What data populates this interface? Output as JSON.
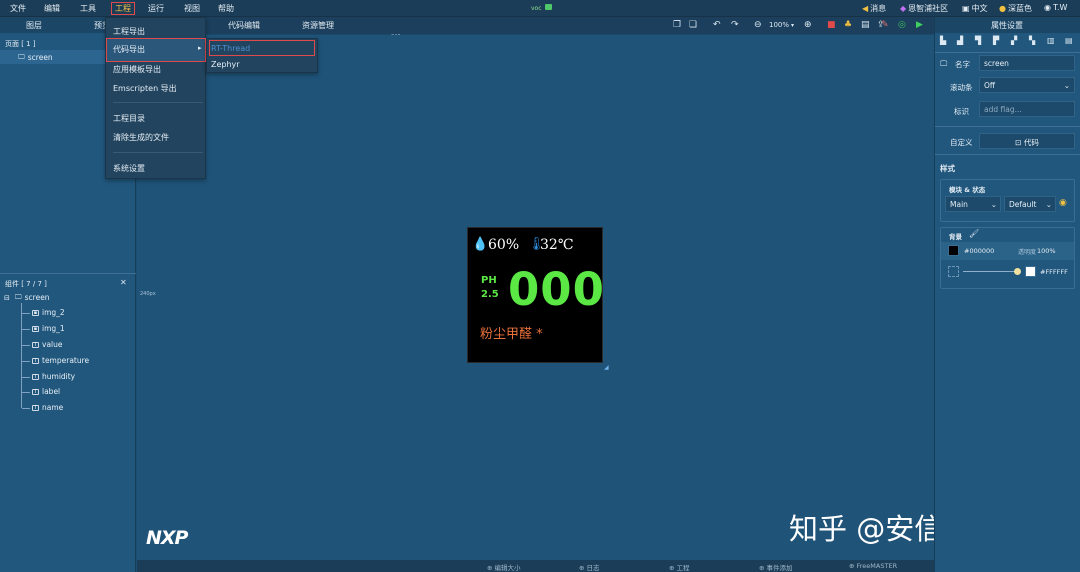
{
  "menubar": {
    "items": [
      "文件",
      "编辑",
      "工具",
      "工程",
      "运行",
      "视图",
      "帮助"
    ],
    "center_logo": "voc",
    "right_items": [
      "消息",
      "恩智浦社区",
      "中文",
      "深蓝色",
      "T.W"
    ]
  },
  "left_panel": {
    "tabs": [
      "图层",
      "预览"
    ],
    "pages_title": "页面 [ 1 ]",
    "pages": [
      "screen"
    ],
    "widgets_title": "组件 [ 7 / 7 ]",
    "widget_root": "screen",
    "widgets": [
      "img_2",
      "img_1",
      "value",
      "temperature",
      "humidity",
      "label",
      "name"
    ]
  },
  "toolbar": {
    "tabs": [
      "代码编辑",
      "资源管理"
    ],
    "zoom": "100%"
  },
  "ruler": {
    "top_label": "240px",
    "left_label": "240px"
  },
  "project_menu": {
    "items": [
      "工程导出",
      "代码导出",
      "应用模板导出",
      "Emscripten 导出",
      "工程目录",
      "清除生成的文件",
      "系统设置"
    ],
    "submenu": [
      "RT-Thread",
      "Zephyr"
    ]
  },
  "device": {
    "humidity": "60%",
    "temperature": "32℃",
    "ph_label_line1": "PH",
    "ph_label_line2": "2.5",
    "value": "000",
    "label": "粉尘甲醛 *",
    "colors": {
      "green": "#5be845",
      "orange": "#e8703a",
      "white": "#ffffff",
      "blue": "#2f8fe0"
    }
  },
  "brand": {
    "logo": "NXP",
    "watermark": "知乎 @安信可科技"
  },
  "right_panel": {
    "title": "属性设置",
    "name_label": "名字",
    "name_value": "screen",
    "scroll_label": "滚动条",
    "scroll_value": "Off",
    "flag_label": "标识",
    "flag_placeholder": "add flag...",
    "custom_label": "自定义",
    "code_button": "代码",
    "style_title": "样式",
    "module_state_title": "模块 & 状态",
    "part_select": "Main",
    "state_select": "Default",
    "bg_title": "背景",
    "bg_color": "#000000",
    "opacity_label": "透明度",
    "opacity_value": "100%",
    "gradient_color": "#FFFFFF"
  },
  "statusbar": {
    "items": [
      "⊕ 编辑大小",
      "⊕ 日志",
      "⊕ 工程",
      "⊕ 事件添加",
      "⊕ FreeMASTER"
    ]
  }
}
